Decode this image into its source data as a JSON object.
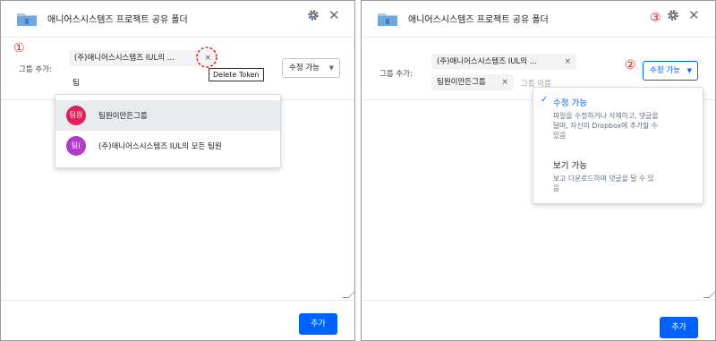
{
  "left": {
    "title": "애니어스시스템즈 프로젝트 공유 폴더",
    "annotation": "①",
    "group_add_label": "그룹 추가:",
    "token_label": "(주)애니어스시스템즈 IUL의 ...",
    "token_close": "×",
    "input_value": "팀",
    "tooltip": "Delete Token",
    "permission": "수정 가능",
    "suggestions": [
      {
        "avatar": "팀원",
        "label": "팀원이만든그룹",
        "color": "#e0205a"
      },
      {
        "avatar": "팀(",
        "label": "(주)애니어스시스템즈 IUL의 모든 팀원",
        "color": "#b03ac9"
      }
    ],
    "add_button": "추가"
  },
  "right": {
    "title": "애니어스시스템즈 프로젝트 공유 폴더",
    "annotation_3": "③",
    "annotation_2": "②",
    "group_add_label": "그룹 추가:",
    "tokens": [
      {
        "label": "(주)애니어스시스템즈 IUL의 ...",
        "close": "×"
      },
      {
        "label": "팀원이만든그룹",
        "close": "×"
      }
    ],
    "input_placeholder": "그룹 이름",
    "permission": "수정 가능",
    "options": [
      {
        "check": "✓",
        "title": "수정 가능",
        "desc": [
          "파일을 수정하거나 삭제하고, 댓글을",
          "달며, 자신의 Dropbox에 추가할 수",
          "있음"
        ]
      },
      {
        "check": "",
        "title": "보기 가능",
        "desc": [
          "보고 다운로드하며 댓글을 달 수 있",
          "음"
        ]
      }
    ],
    "add_button": "추가"
  },
  "colors": {
    "accent": "#0061fe",
    "annotation": "#e02020",
    "folder": "#6fa8dc"
  }
}
